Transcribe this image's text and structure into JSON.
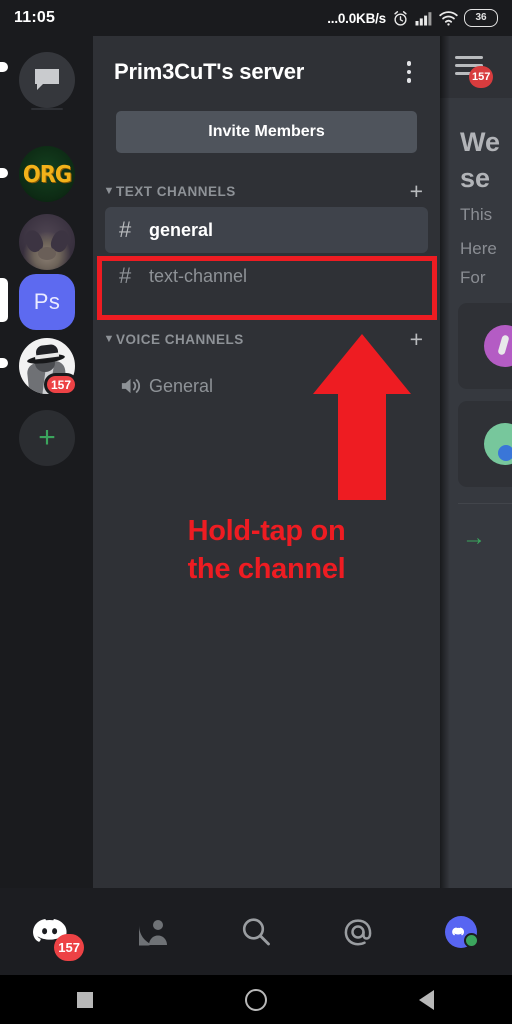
{
  "status_bar": {
    "clock": "11:05",
    "net_speed": "...0.0KB/s",
    "battery_level": "36",
    "icons": [
      "alarm-clock-icon",
      "signal-bars-icon",
      "wifi-icon",
      "battery-icon"
    ]
  },
  "server_rail": {
    "items": [
      {
        "id": "dm",
        "label": "Direct Messages",
        "icon": "chat-bubble-icon",
        "type": "dm",
        "selected": false,
        "badge": null
      },
      {
        "id": "org",
        "label": "ORG",
        "icon": "server-avatar-org",
        "type": "server",
        "selected": false,
        "badge": null,
        "unread": true
      },
      {
        "id": "pig",
        "label": "Pig server",
        "icon": "server-avatar-photo",
        "type": "server",
        "selected": false,
        "badge": null
      },
      {
        "id": "ps",
        "label": "Ps",
        "icon": "server-avatar-ps",
        "type": "server",
        "selected": true,
        "badge": null
      },
      {
        "id": "gangster",
        "label": "Gangster server",
        "icon": "server-avatar-gangster",
        "type": "server",
        "selected": false,
        "badge": "157",
        "unread": true
      },
      {
        "id": "add",
        "label": "Add a Server",
        "icon": "plus-icon",
        "type": "add",
        "selected": false,
        "badge": null
      }
    ]
  },
  "channel_panel": {
    "server_name": "Prim3CuT's server",
    "menu_icon": "more-vertical-icon",
    "invite_button": "Invite Members",
    "sections": [
      {
        "title": "TEXT CHANNELS",
        "collapse_icon": "chevron-down-icon",
        "add_icon": "plus-icon",
        "channels": [
          {
            "name": "general",
            "prefix": "#",
            "selected": true
          },
          {
            "name": "text-channel",
            "prefix": "#",
            "selected": false
          }
        ]
      },
      {
        "title": "VOICE CHANNELS",
        "collapse_icon": "chevron-down-icon",
        "add_icon": "plus-icon",
        "channels": [
          {
            "name": "General",
            "prefix": "speaker",
            "selected": false
          }
        ]
      }
    ]
  },
  "content_pane": {
    "hamburger_icon": "hamburger-menu-icon",
    "header_badge": "157",
    "heading_line1": "We",
    "heading_line2": "se",
    "body_line1": "This",
    "body_line2": "Here",
    "body_line3": "For",
    "arrow_link": "→"
  },
  "annotations": {
    "instruction": "Hold-tap on the channel",
    "instruction_line1": "Hold-tap on",
    "instruction_line2": "the channel",
    "highlight_target": "general",
    "color": "#ee1c22",
    "arrow_icon": "up-arrow-icon"
  },
  "bottom_nav": {
    "items": [
      {
        "id": "home",
        "label": "Home",
        "icon": "discord-home-icon",
        "badge": "157",
        "selected": true
      },
      {
        "id": "friends",
        "label": "Friends",
        "icon": "friends-person-icon",
        "badge": null,
        "selected": false
      },
      {
        "id": "search",
        "label": "Search",
        "icon": "search-icon",
        "badge": null,
        "selected": false
      },
      {
        "id": "mentions",
        "label": "Mentions",
        "icon": "at-mention-icon",
        "badge": null,
        "selected": false
      },
      {
        "id": "profile",
        "label": "You",
        "icon": "user-avatar-icon",
        "badge": null,
        "selected": false,
        "presence": "online"
      }
    ]
  },
  "android_nav": {
    "recents": "recents-square-icon",
    "home": "home-circle-icon",
    "back": "back-triangle-icon"
  }
}
